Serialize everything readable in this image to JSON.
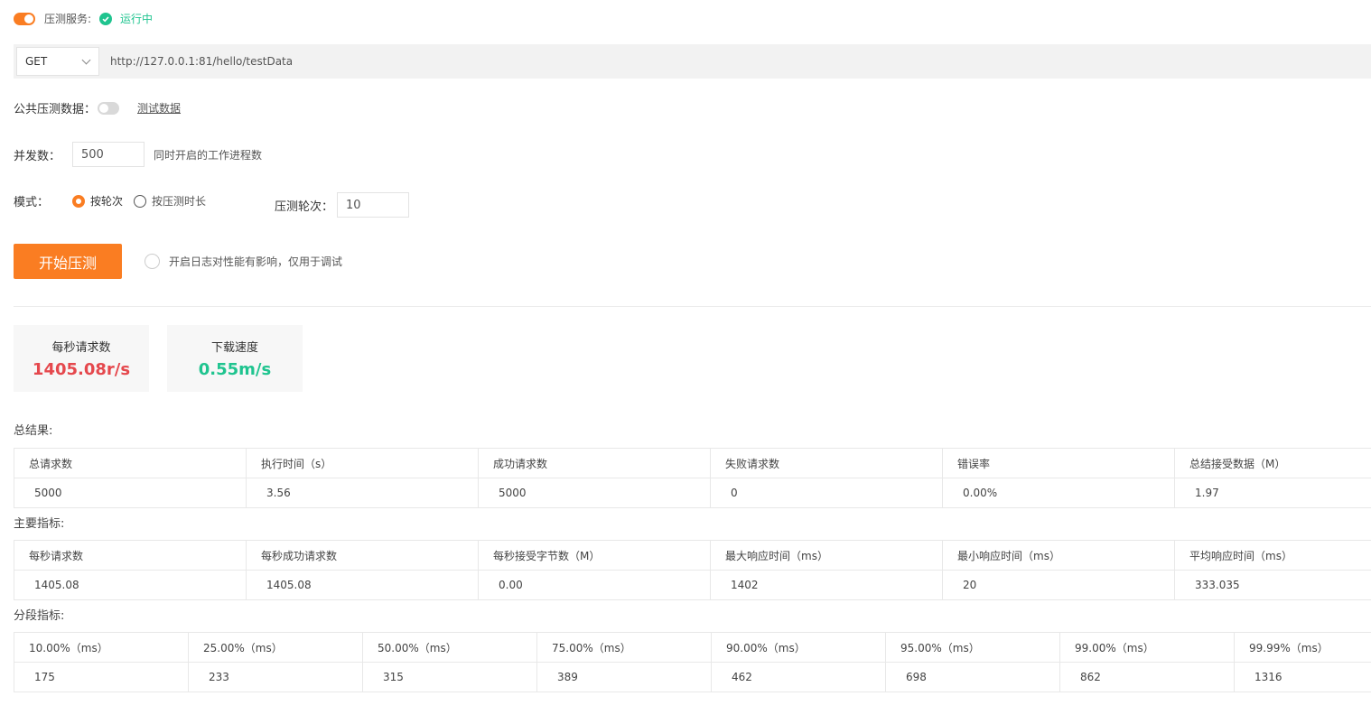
{
  "status": {
    "label": "压测服务:",
    "state": "运行中",
    "toggle_on": true,
    "state_color": "#1fc48f"
  },
  "request": {
    "method": "GET",
    "url": "http://127.0.0.1:81/hello/testData"
  },
  "public_data": {
    "label": "公共压测数据：",
    "toggle_on": false,
    "link": "测试数据"
  },
  "concurrency": {
    "label": "并发数：",
    "value": "500",
    "hint": "同时开启的工作进程数"
  },
  "mode": {
    "label": "模式：",
    "options": [
      "按轮次",
      "按压测时长"
    ],
    "selected": "按轮次",
    "rounds_label": "压测轮次：",
    "rounds_value": "10"
  },
  "actions": {
    "start_label": "开始压测",
    "log_label": "开启日志对性能有影响，仅用于调试"
  },
  "stats": [
    {
      "title": "每秒请求数",
      "value": "1405.08r/s",
      "color": "#e5484d"
    },
    {
      "title": "下载速度",
      "value": "0.55m/s",
      "color": "#1fc48f"
    }
  ],
  "total": {
    "title": "总结果:",
    "headers": [
      "总请求数",
      "执行时间（s）",
      "成功请求数",
      "失败请求数",
      "错误率",
      "总结接受数据（M）"
    ],
    "values": [
      "5000",
      "3.56",
      "5000",
      "0",
      "0.00%",
      "1.97"
    ]
  },
  "main": {
    "title": "主要指标:",
    "headers": [
      "每秒请求数",
      "每秒成功请求数",
      "每秒接受字节数（M）",
      "最大响应时间（ms）",
      "最小响应时间（ms）",
      "平均响应时间（ms）"
    ],
    "values": [
      "1405.08",
      "1405.08",
      "0.00",
      "1402",
      "20",
      "333.035"
    ]
  },
  "segment": {
    "title": "分段指标:",
    "headers": [
      "10.00%（ms）",
      "25.00%（ms）",
      "50.00%（ms）",
      "75.00%（ms）",
      "90.00%（ms）",
      "95.00%（ms）",
      "99.00%（ms）",
      "99.99%（ms）"
    ],
    "values": [
      "175",
      "233",
      "315",
      "389",
      "462",
      "698",
      "862",
      "1316"
    ]
  }
}
